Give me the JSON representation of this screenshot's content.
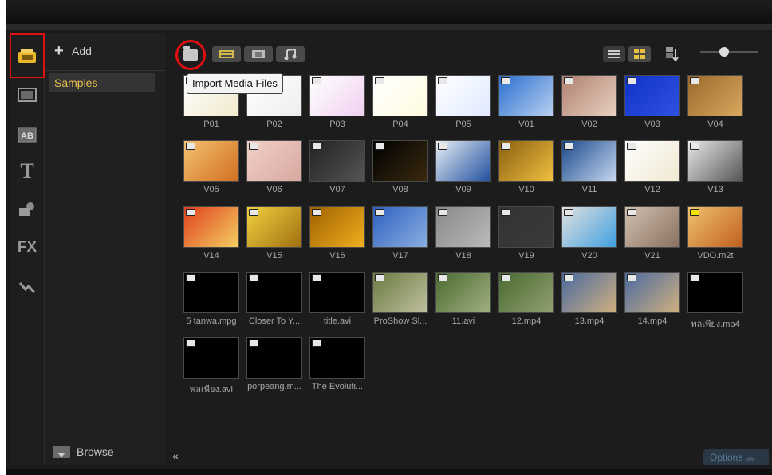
{
  "library": {
    "add_label": "Add",
    "folder_name": "Samples",
    "browse_label": "Browse"
  },
  "toolbar": {
    "import_tooltip": "Import Media Files"
  },
  "footer": {
    "options_label": "Options"
  },
  "grid": {
    "items": [
      {
        "label": "P01",
        "kind": "photo",
        "colors": [
          "#fff",
          "#f1eacd"
        ]
      },
      {
        "label": "P02",
        "kind": "photo",
        "colors": [
          "#fff",
          "#eee"
        ]
      },
      {
        "label": "P03",
        "kind": "photo",
        "colors": [
          "#fff",
          "#f0d0f0"
        ]
      },
      {
        "label": "P04",
        "kind": "photo",
        "colors": [
          "#fff",
          "#fffbe0"
        ]
      },
      {
        "label": "P05",
        "kind": "video",
        "colors": [
          "#ffffff",
          "#dfe9ff"
        ]
      },
      {
        "label": "V01",
        "kind": "video",
        "colors": [
          "#2a6fd0",
          "#b8d0f0"
        ]
      },
      {
        "label": "V02",
        "kind": "video",
        "colors": [
          "#b08070",
          "#e8d0c0"
        ]
      },
      {
        "label": "V03",
        "kind": "video",
        "colors": [
          "#1033c8",
          "#3050e0"
        ]
      },
      {
        "label": "V04",
        "kind": "video",
        "colors": [
          "#9a6a2a",
          "#d8a860"
        ]
      },
      {
        "label": "V05",
        "kind": "video",
        "colors": [
          "#f4c070",
          "#d07020"
        ]
      },
      {
        "label": "V06",
        "kind": "audio",
        "colors": [
          "#f2d0c8",
          "#d8a8a0"
        ]
      },
      {
        "label": "V07",
        "kind": "video",
        "colors": [
          "#222",
          "#555"
        ]
      },
      {
        "label": "V08",
        "kind": "video",
        "colors": [
          "#000",
          "#3a2a10"
        ]
      },
      {
        "label": "V09",
        "kind": "video",
        "colors": [
          "#e8eef4",
          "#2050a0"
        ]
      },
      {
        "label": "V10",
        "kind": "audio",
        "colors": [
          "#8a6010",
          "#f0c040"
        ]
      },
      {
        "label": "V11",
        "kind": "video",
        "colors": [
          "#1a4a8a",
          "#c8d8f0"
        ]
      },
      {
        "label": "V12",
        "kind": "video",
        "colors": [
          "#fff",
          "#f0e8d0"
        ]
      },
      {
        "label": "V13",
        "kind": "video",
        "colors": [
          "#e8e8e8",
          "#555"
        ]
      },
      {
        "label": "V14",
        "kind": "audio",
        "colors": [
          "#e04020",
          "#f4d060"
        ]
      },
      {
        "label": "V15",
        "kind": "video",
        "colors": [
          "#f0d040",
          "#a07010"
        ]
      },
      {
        "label": "V16",
        "kind": "video",
        "colors": [
          "#a06000",
          "#f0b020"
        ]
      },
      {
        "label": "V17",
        "kind": "video",
        "colors": [
          "#3060c0",
          "#8ab0e0"
        ]
      },
      {
        "label": "V18",
        "kind": "video",
        "colors": [
          "#888",
          "#bbb"
        ]
      },
      {
        "label": "V19",
        "kind": "video",
        "colors": [
          "#333",
          "#3a3a3a"
        ]
      },
      {
        "label": "V20",
        "kind": "video",
        "colors": [
          "#e0e0e0",
          "#40a0e0"
        ]
      },
      {
        "label": "V21",
        "kind": "video",
        "colors": [
          "#d0c0b0",
          "#8a7060"
        ]
      },
      {
        "label": "VDO.m2t",
        "kind": "video-yellow",
        "colors": [
          "#f0c070",
          "#c06020"
        ]
      },
      {
        "label": "5 tanwa.mpg",
        "kind": "video",
        "colors": [
          "#000",
          "#000"
        ]
      },
      {
        "label": "Closer To Y...",
        "kind": "video",
        "colors": [
          "#000",
          "#000"
        ]
      },
      {
        "label": "title.avi",
        "kind": "video",
        "colors": [
          "#000",
          "#000"
        ]
      },
      {
        "label": "ProShow Sl...",
        "kind": "video",
        "colors": [
          "#6a7a40",
          "#c0c0a0"
        ]
      },
      {
        "label": "11.avi",
        "kind": "video",
        "colors": [
          "#4a6a30",
          "#a0b080"
        ]
      },
      {
        "label": "12.mp4",
        "kind": "video",
        "colors": [
          "#4a6a30",
          "#90a070"
        ]
      },
      {
        "label": "13.mp4",
        "kind": "video",
        "colors": [
          "#4a6aa0",
          "#d0b080"
        ]
      },
      {
        "label": "14.mp4",
        "kind": "video",
        "colors": [
          "#4a6aa0",
          "#d0b080"
        ]
      },
      {
        "label": "พลเพียง.mp4",
        "kind": "video",
        "colors": [
          "#000",
          "#000"
        ]
      },
      {
        "label": "พลเพียง.avi",
        "kind": "video",
        "colors": [
          "#000",
          "#000"
        ]
      },
      {
        "label": "porpeang.m...",
        "kind": "video",
        "colors": [
          "#000",
          "#000"
        ]
      },
      {
        "label": "The Evoluti...",
        "kind": "video",
        "colors": [
          "#000",
          "#000"
        ]
      }
    ]
  },
  "icons": [
    "media-library-icon",
    "video-filter-icon",
    "title-ab-icon",
    "text-t-icon",
    "graphics-icon",
    "fx-icon",
    "path-icon",
    "import-folder-icon",
    "show-video-icon",
    "show-photo-icon",
    "show-audio-icon",
    "list-view-icon",
    "thumbnail-view-icon",
    "sort-icon",
    "browse-icon"
  ]
}
